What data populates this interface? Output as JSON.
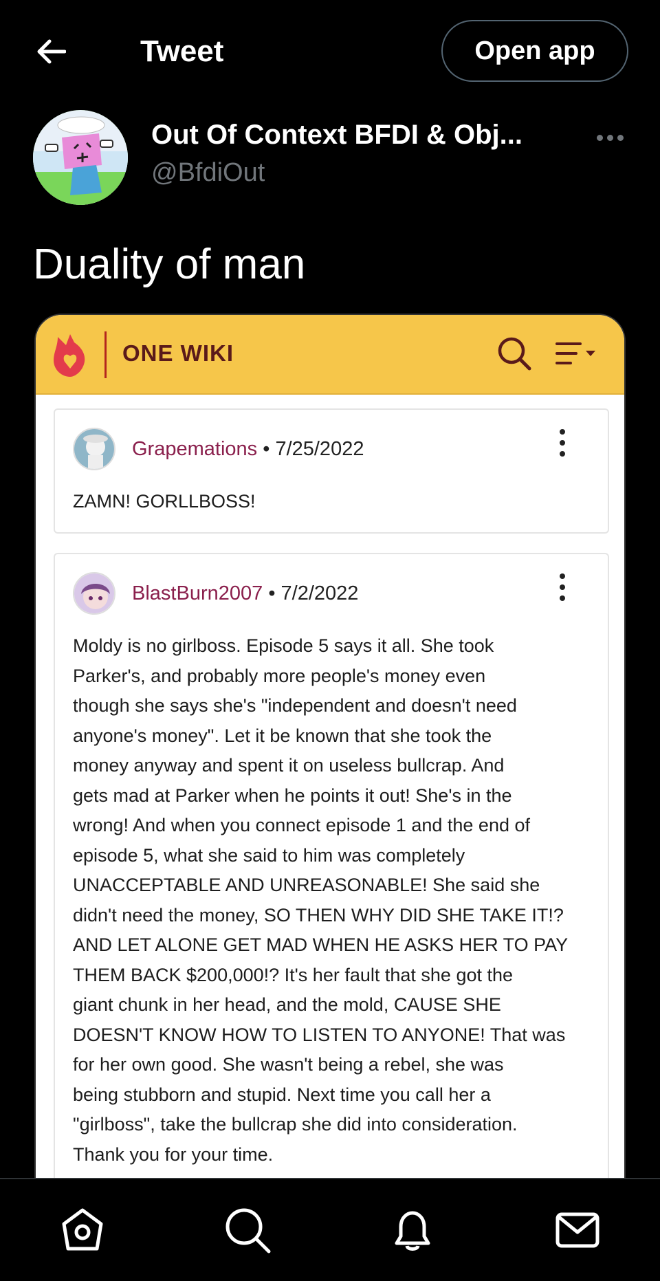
{
  "header": {
    "title": "Tweet",
    "open_app_label": "Open app"
  },
  "author": {
    "display_name": "Out Of Context BFDI & Obj...",
    "handle": "@BfdiOut"
  },
  "tweet": {
    "text": "Duality of man"
  },
  "wiki": {
    "name": "ONE WIKI",
    "brand_color": "#f6c64a",
    "comments": [
      {
        "user": "Grapemations",
        "separator": "•",
        "date": "7/25/2022",
        "body": "ZAMN!  GORLLBOSS!"
      },
      {
        "user": "BlastBurn2007",
        "separator": "•",
        "date": "7/2/2022",
        "body": "Moldy is no girlboss. Episode 5 says it all. She took\nParker's, and probably more people's money even\nthough she says she's \"independent and doesn't need\nanyone's money\". Let it be known that she took the\nmoney anyway and spent it on useless bullcrap. And\ngets mad at Parker when he points it out! She's in the\nwrong! And when you connect episode 1 and the end of\nepisode 5, what she said to him was completely\nUNACCEPTABLE AND UNREASONABLE! She said she\ndidn't need the money, SO THEN WHY DID SHE TAKE IT!?\nAND LET ALONE GET MAD WHEN HE ASKS HER TO PAY\nTHEM BACK $200,000!? It's her fault that she got the\ngiant chunk in her head, and the mold, CAUSE SHE\nDOESN'T KNOW HOW TO LISTEN TO ANYONE! That was\nfor her own good. She wasn't being a rebel, she was\nbeing stubborn and stupid.  Next time you call her a\n\"girlboss\", take the bullcrap she did into consideration.\nThank you for your time."
      }
    ]
  },
  "bottom_nav": {
    "items": [
      "home-icon",
      "search-icon",
      "bell-icon",
      "mail-icon"
    ]
  }
}
